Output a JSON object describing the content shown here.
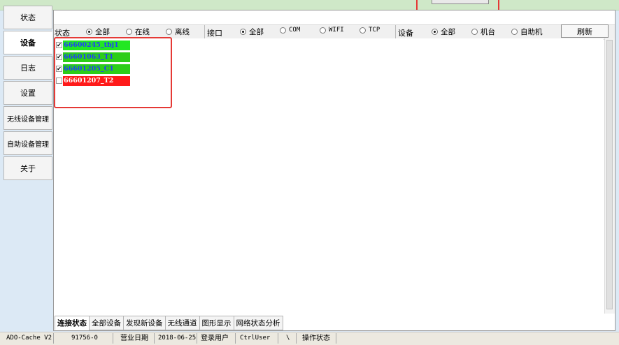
{
  "sidebar": {
    "items": [
      {
        "label": "状态"
      },
      {
        "label": "设备"
      },
      {
        "label": "日志"
      },
      {
        "label": "设置"
      },
      {
        "label": "无线设备管理"
      },
      {
        "label": "自助设备管理"
      },
      {
        "label": "关于"
      }
    ],
    "active": "设备"
  },
  "filters": {
    "status": {
      "label": "状态",
      "options": [
        "全部",
        "在线",
        "离线"
      ],
      "selected": "全部"
    },
    "interface": {
      "label": "接口",
      "options": [
        "全部",
        "COM",
        "WIFI",
        "TCP"
      ],
      "selected": "全部"
    },
    "device": {
      "label": "设备",
      "options": [
        "全部",
        "机台",
        "自助机"
      ],
      "selected": "全部"
    },
    "refresh_label": "刷新"
  },
  "devices": [
    {
      "name": "66600245_tbj1",
      "checked": true,
      "color": "#22e722",
      "text_color": "#1f3cff"
    },
    {
      "name": "66601063_T1",
      "checked": true,
      "color": "#2ccd18",
      "text_color": "#1f3cff"
    },
    {
      "name": "66601205_C1",
      "checked": true,
      "color": "#2ccd18",
      "text_color": "#1f3cff"
    },
    {
      "name": "66601207_T2",
      "checked": false,
      "color": "#ff1a1a",
      "text_color": "#ffffff"
    }
  ],
  "bottom_tabs": [
    "连接状态",
    "全部设备",
    "发现新设备",
    "无线通道",
    "图形显示",
    "网络状态分析"
  ],
  "active_tab": "连接状态",
  "statusbar": {
    "app": "ADO-Cache V2",
    "code": "91756-0",
    "business_date_label": "营业日期",
    "business_date": "2018-06-25",
    "user_label": "登录用户",
    "user": "CtrlUser",
    "sep": "\\",
    "op_label": "操作状态"
  },
  "colors": {
    "highlight_box": "#e53935",
    "online_green": "#22e722",
    "offline_red": "#ff1a1a"
  }
}
